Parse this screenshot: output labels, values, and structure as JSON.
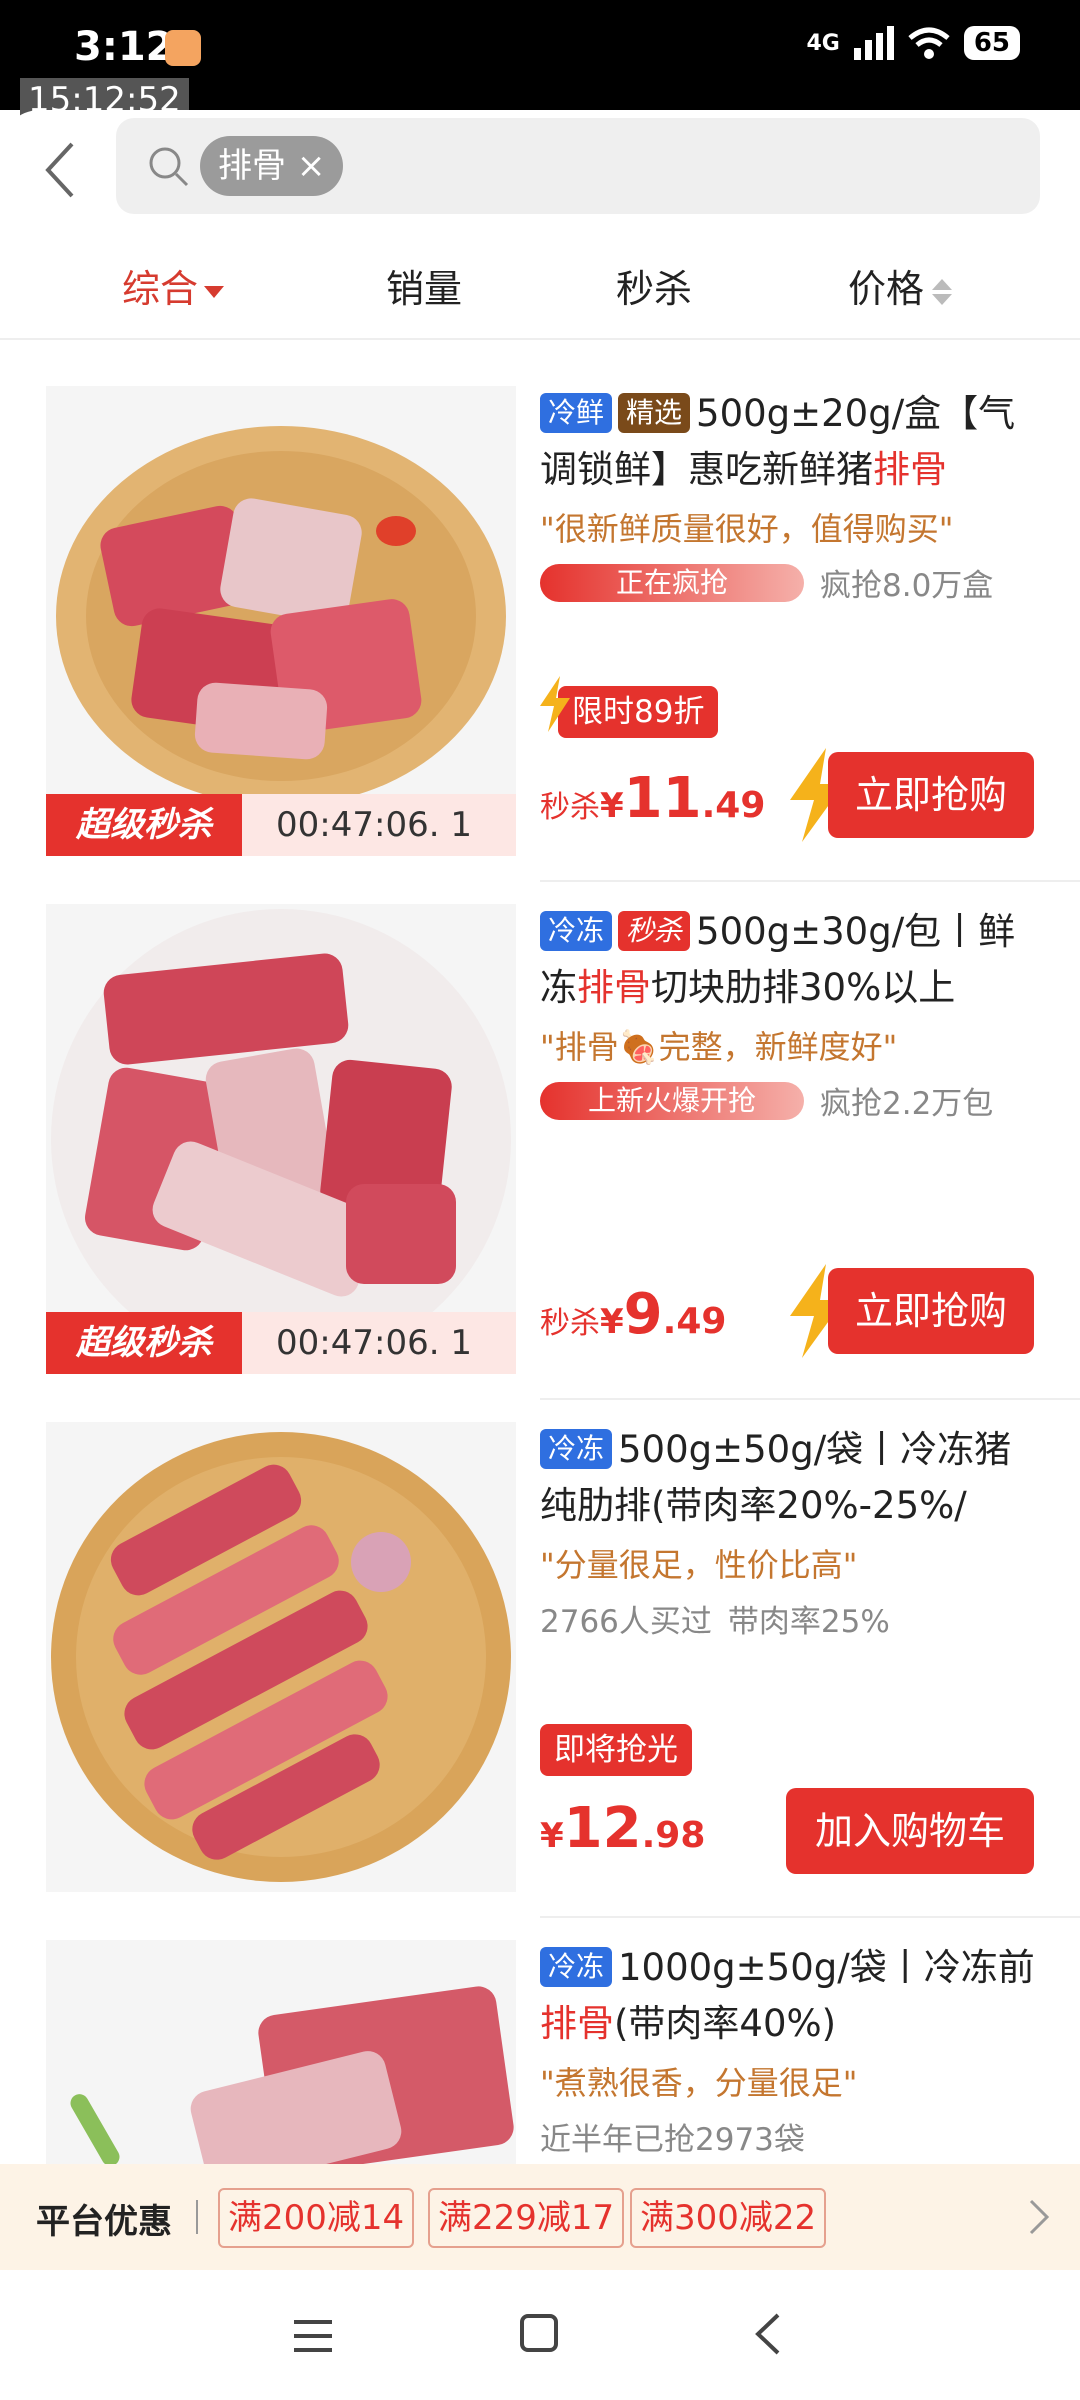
{
  "status_bar": {
    "time": "3:12",
    "overlay_time": "15:12:52",
    "network": "4G",
    "battery": "65"
  },
  "search": {
    "chip_label": "排骨",
    "chip_close": "×"
  },
  "sort_tabs": [
    {
      "label": "综合",
      "active": true
    },
    {
      "label": "销量",
      "active": false
    },
    {
      "label": "秒杀",
      "active": false
    },
    {
      "label": "价格",
      "active": false
    }
  ],
  "products": [
    {
      "tags": [
        "冷鲜",
        "精选"
      ],
      "title_pre": "500g±20g/盒【气调锁鲜】惠吃新鲜猪",
      "title_hl": "排骨",
      "title_post": "",
      "quote": "\"很新鲜质量很好，值得购买\"",
      "rank_label": "正在疯抢",
      "sold": "疯抢8.0万盒",
      "promo": "限时89折",
      "price_prefix": "秒杀",
      "price_yen": "¥",
      "price_int": "11",
      "price_dec": ".49",
      "button": "立即抢购",
      "flash_label": "超级秒杀",
      "countdown": "00:47:06. 1"
    },
    {
      "tags": [
        "冷冻",
        "秒杀"
      ],
      "title_pre": "500g±30g/包丨鲜冻",
      "title_hl": "排骨",
      "title_post": "切块肋排30%以上",
      "quote": "\"排骨🍖完整，新鲜度好\"",
      "rank_label": "上新火爆开抢",
      "sold": "疯抢2.2万包",
      "price_prefix": "秒杀",
      "price_yen": "¥",
      "price_int": "9",
      "price_dec": ".49",
      "button": "立即抢购",
      "flash_label": "超级秒杀",
      "countdown": "00:47:06. 1"
    },
    {
      "tags": [
        "冷冻"
      ],
      "title_pre": "500g±50g/袋丨冷冻猪纯肋排(带肉率20%-25%/",
      "quote": "\"分量很足，性价比高\"",
      "sold_count": "2766人买过",
      "meat_ratio": "带肉率25%",
      "promo": "即将抢光",
      "price_yen": "¥",
      "price_int": "12",
      "price_dec": ".98",
      "button": "加入购物车"
    },
    {
      "tags": [
        "冷冻"
      ],
      "title_pre": "1000g±50g/袋丨冷冻前",
      "title_hl": "排骨",
      "title_post": "(带肉率40%)",
      "quote": "\"煮熟很香，分量很足\"",
      "sold_count": "近半年已抢2973袋"
    }
  ],
  "coupons": {
    "title": "平台优惠",
    "items": [
      "满200减14",
      "满229减17",
      "满300减22"
    ]
  },
  "colors": {
    "accent": "#e5322d",
    "tag_blue": "#2f6fe0",
    "quote": "#c4762f"
  }
}
